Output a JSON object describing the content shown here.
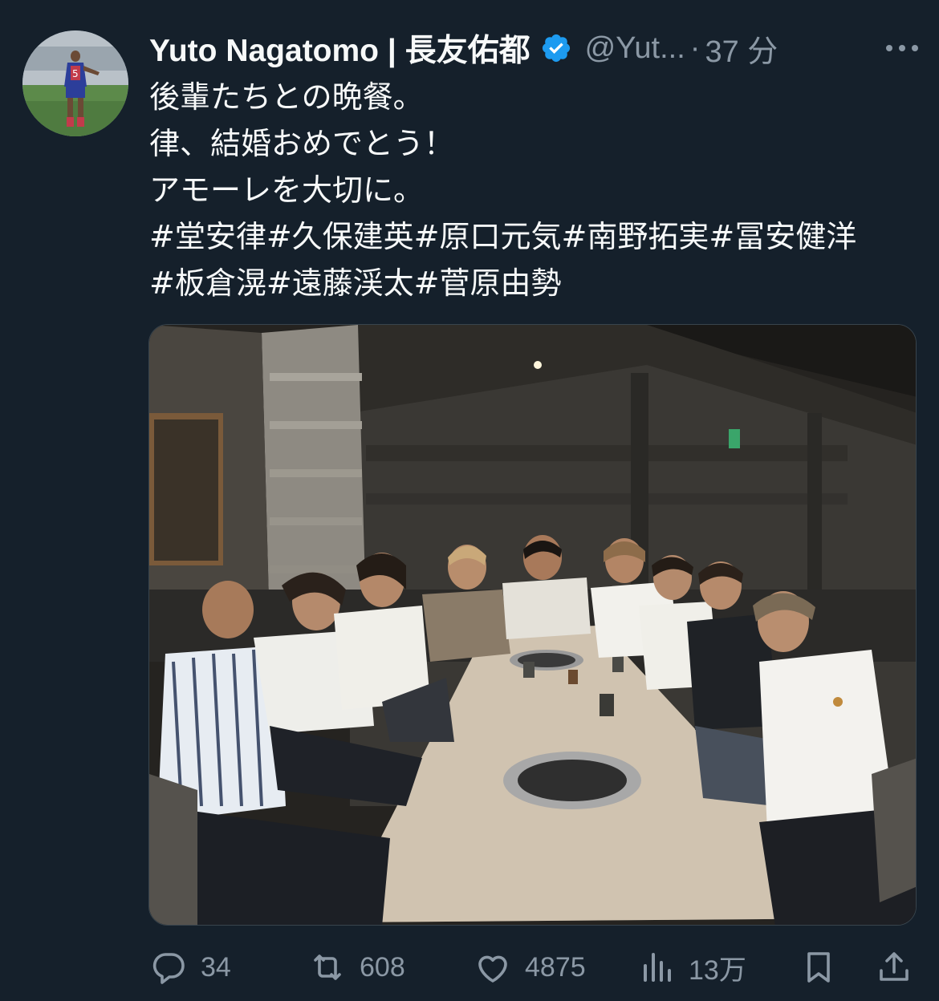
{
  "author": {
    "display_name": "Yuto Nagatomo | 長友佑都",
    "handle": "@Yut...",
    "separator": "·",
    "time": "37 分",
    "verified_color": "#1d9bf0"
  },
  "tweet": {
    "lines": [
      "後輩たちとの晩餐。",
      "律、結婚おめでとう！",
      "アモーレを大切に。",
      "#堂安律#久保建英#原口元気#南野拓実#冨安健洋",
      "#板倉滉#遠藤渓太#菅原由勢"
    ]
  },
  "actions": {
    "replies": "34",
    "reposts": "608",
    "likes": "4875",
    "views": "13万"
  },
  "icons": {
    "more": "more-icon",
    "reply": "reply-icon",
    "repost": "repost-icon",
    "like": "like-icon",
    "views": "views-icon",
    "bookmark": "bookmark-icon",
    "share": "share-icon"
  },
  "colors": {
    "background": "#15202b",
    "text": "#f7f9f9",
    "secondary": "#8b98a5"
  }
}
